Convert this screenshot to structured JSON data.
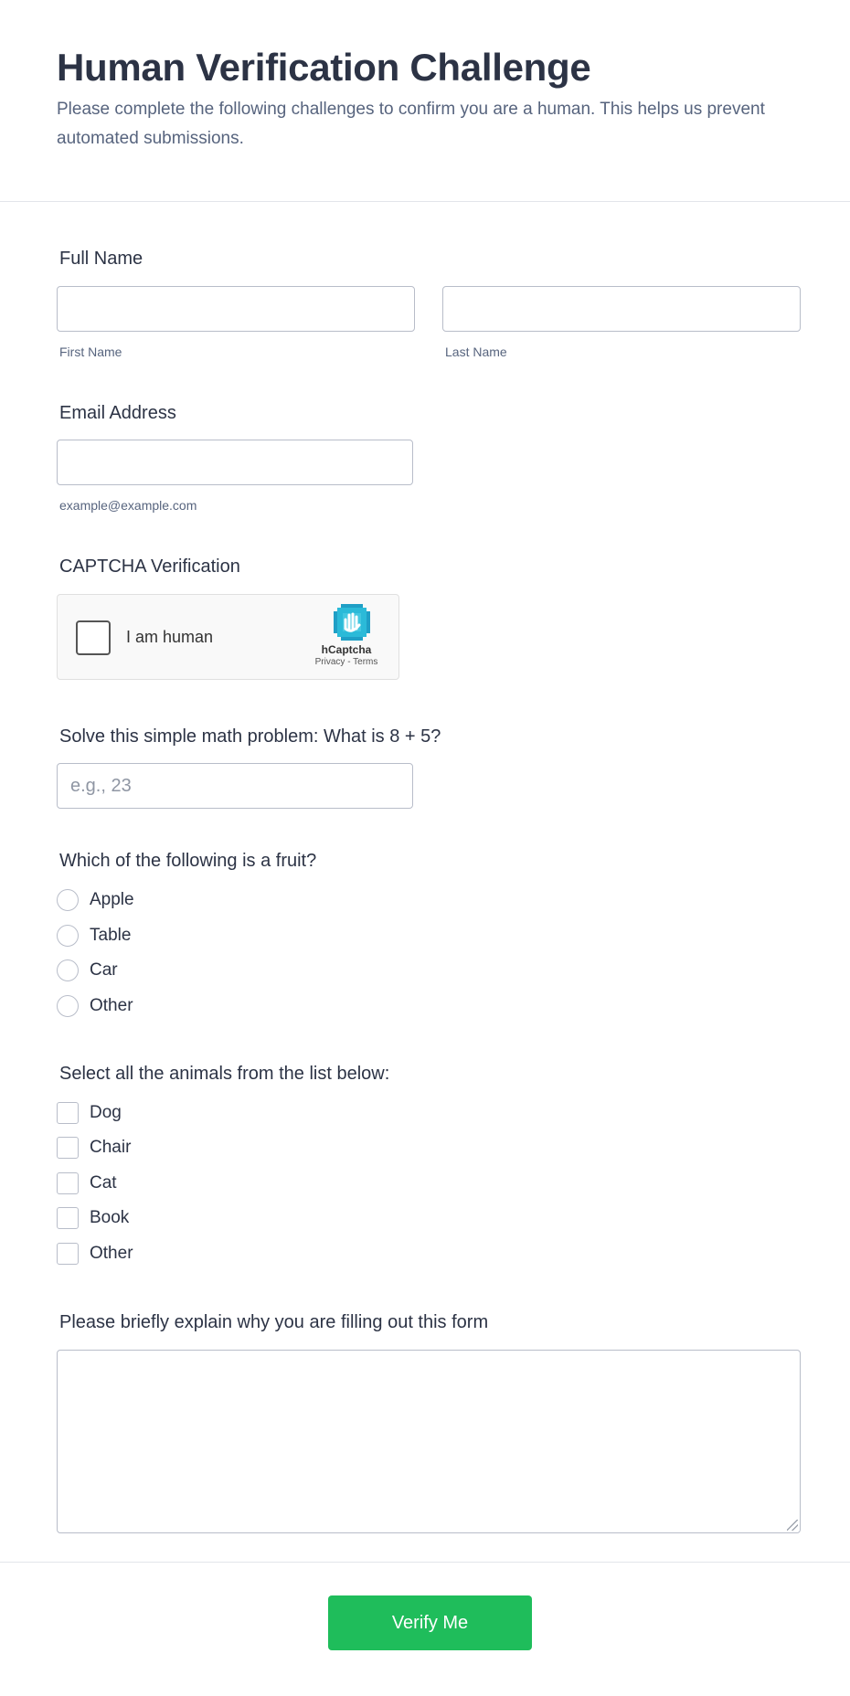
{
  "header": {
    "title": "Human Verification Challenge",
    "subtitle": "Please complete the following challenges to confirm you are a human. This helps us prevent automated submissions."
  },
  "full_name": {
    "label": "Full Name",
    "first_value": "",
    "last_value": "",
    "first_sublabel": "First Name",
    "last_sublabel": "Last Name"
  },
  "email": {
    "label": "Email Address",
    "value": "",
    "sublabel": "example@example.com"
  },
  "captcha": {
    "label": "CAPTCHA Verification",
    "checkbox_text": "I am human",
    "brand": "hCaptcha",
    "links": "Privacy - Terms",
    "icon": "hcaptcha-hand-icon"
  },
  "math": {
    "label": "Solve this simple math problem: What is 8 + 5?",
    "placeholder": "e.g., 23",
    "value": ""
  },
  "fruit": {
    "label": "Which of the following is a fruit?",
    "options": [
      "Apple",
      "Table",
      "Car",
      "Other"
    ]
  },
  "animals": {
    "label": "Select all the animals from the list below:",
    "options": [
      "Dog",
      "Chair",
      "Cat",
      "Book",
      "Other"
    ]
  },
  "reason": {
    "label": "Please briefly explain why you are filling out this form",
    "value": ""
  },
  "submit": {
    "label": "Verify Me"
  },
  "colors": {
    "accent": "#1fbd5b",
    "text": "#2c3345",
    "muted": "#57647e",
    "border": "#b8bdc9"
  }
}
